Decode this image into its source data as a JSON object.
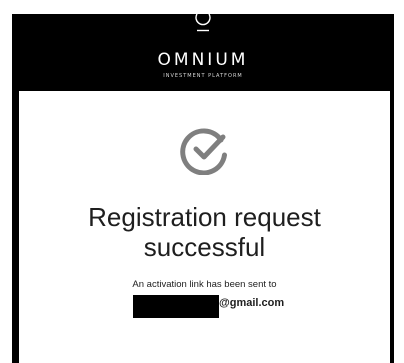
{
  "brand": {
    "name": "OMNIUM",
    "tagline": "INVESTMENT PLATFORM"
  },
  "confirmation": {
    "icon": "check-circle-icon",
    "title_line1": "Registration request",
    "title_line2": "successful",
    "message": "An activation link has been sent to",
    "email_domain": "@gmail.com"
  },
  "colors": {
    "header_background": "#000000",
    "icon_gray": "#7f7f7f",
    "text": "#1e1e1e"
  }
}
